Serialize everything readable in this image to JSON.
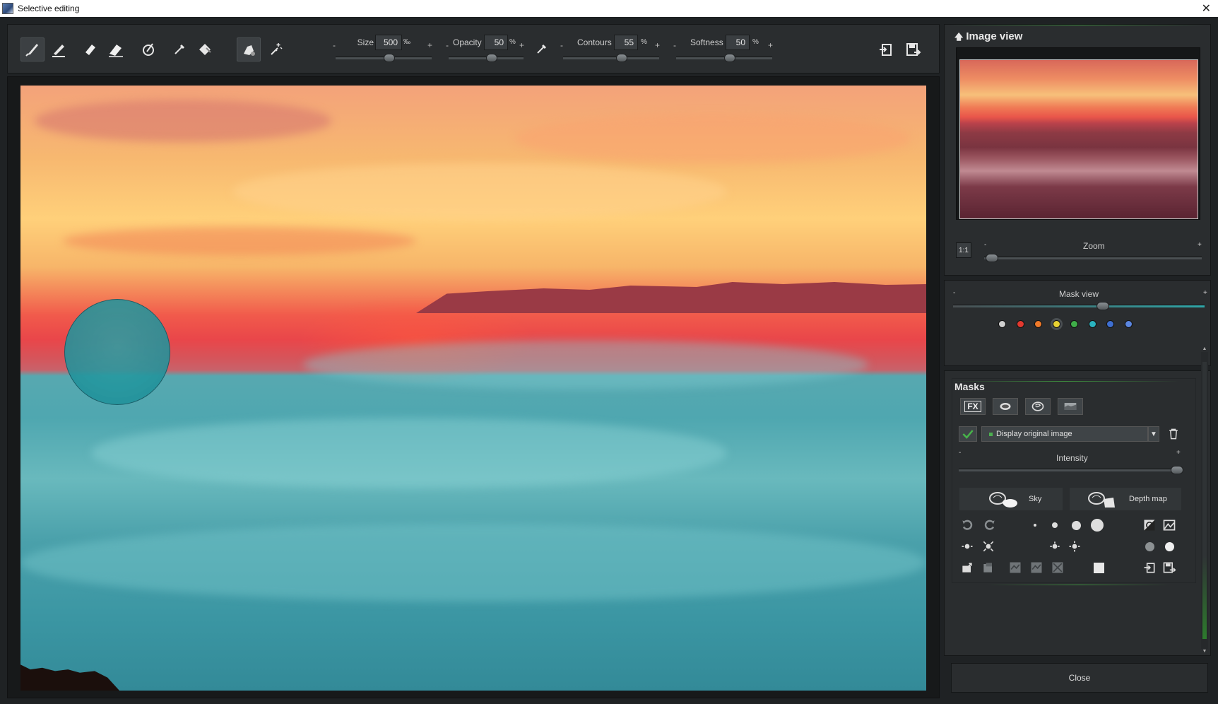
{
  "window": {
    "title": "Selective editing",
    "close_glyph": "✕"
  },
  "toolbar": {
    "tools": [
      {
        "name": "brush-tool",
        "active": true
      },
      {
        "name": "brush-add-tool",
        "active": false
      },
      {
        "name": "eraser-tool",
        "active": false
      },
      {
        "name": "eraser-soft-tool",
        "active": false
      },
      {
        "name": "gradient-brush-tool",
        "active": false
      },
      {
        "name": "pipette-tool",
        "active": false
      },
      {
        "name": "fill-tool",
        "active": false
      },
      {
        "name": "smart-brush-tool",
        "active": true
      },
      {
        "name": "magic-wand-tool",
        "active": false
      }
    ],
    "size": {
      "label": "Size",
      "value": "500",
      "unit": "‰",
      "minus": "-",
      "plus": "+",
      "level": 0.5
    },
    "opacity": {
      "label": "Opacity",
      "value": "50",
      "unit": "%",
      "minus": "-",
      "plus": "+",
      "level": 0.5
    },
    "contours": {
      "label": "Contours",
      "value": "55",
      "unit": "%",
      "minus": "-",
      "plus": "+",
      "level": 0.55
    },
    "softness": {
      "label": "Softness",
      "value": "50",
      "unit": "%",
      "minus": "-",
      "plus": "+",
      "level": 0.5
    }
  },
  "image_view": {
    "title": "Image view",
    "zoom_label": "Zoom",
    "zoom_reset": "1:1",
    "minus": "-",
    "plus": "+",
    "zoom_level": 0.0
  },
  "mask_view": {
    "label": "Mask view",
    "minus": "-",
    "plus": "+",
    "level": 0.6,
    "colors": [
      "#d0d0d0",
      "#e2392f",
      "#ef7a2a",
      "#e8d233",
      "#3fae49",
      "#2ab3bf",
      "#3e6fd1",
      "#5b86e0"
    ],
    "selected_color_index": 3
  },
  "masks": {
    "title": "Masks",
    "tabs": [
      "FX",
      "selective-mask",
      "ai-mask",
      "landscape-mask"
    ],
    "dropdown_value": "Display original image",
    "intensity_label": "Intensity",
    "minus": "-",
    "plus": "+",
    "intensity_level": 1.0,
    "sky_label": "Sky",
    "depth_label": "Depth map"
  },
  "close_label": "Close"
}
